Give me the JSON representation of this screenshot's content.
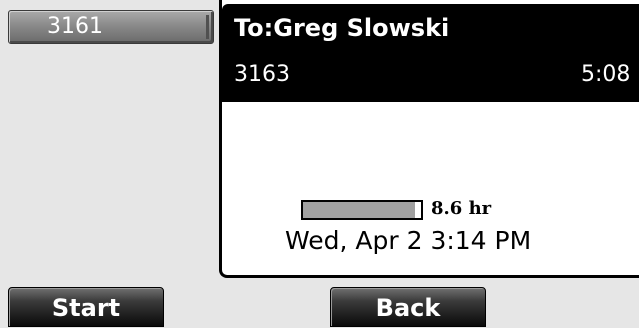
{
  "line_key": {
    "label": "3161"
  },
  "call": {
    "to_label": "To:Greg Slowski",
    "number": "3163",
    "duration": "5:08"
  },
  "status": {
    "battery_level": 0.95,
    "battery_label": "8.6 hr",
    "datetime": "Wed, Apr 2  3:14 PM"
  },
  "softkeys": {
    "start": "Start",
    "back": "Back"
  },
  "colors": {
    "screen_bg": "#e6e6e6",
    "panel_bg": "#ffffff",
    "header_bg": "#000000",
    "battery_fill": "#a0a0a0"
  }
}
